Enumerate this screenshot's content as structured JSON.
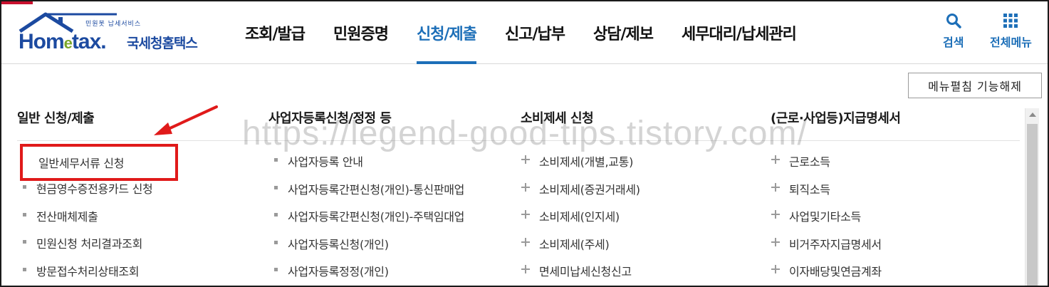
{
  "logo": {
    "tagline": "민원봇 납세서비스",
    "name_main": "Hom",
    "name_e": "e",
    "name_tail": "tax.",
    "name_kor": "국세청홈택스"
  },
  "nav": [
    {
      "label": "조회/발급",
      "active": false
    },
    {
      "label": "민원증명",
      "active": false
    },
    {
      "label": "신청/제출",
      "active": true
    },
    {
      "label": "신고/납부",
      "active": false
    },
    {
      "label": "상담/제보",
      "active": false
    },
    {
      "label": "세무대리/납세관리",
      "active": false
    }
  ],
  "header_actions": {
    "search": {
      "label": "검색",
      "icon": "search-icon"
    },
    "all_menu": {
      "label": "전체메뉴",
      "icon": "grid-icon"
    }
  },
  "toggle_button": "메뉴펼침 기능해제",
  "watermark": "https://legend-good-tips.tistory.com/",
  "columns": [
    {
      "title": "일반 신청/제출",
      "bullet": "square",
      "highlighted": "일반세무서류 신청",
      "items": [
        "현금영수증전용카드 신청",
        "전산매체제출",
        "민원신청 처리결과조회",
        "방문접수처리상태조회"
      ]
    },
    {
      "title": "사업자등록신청/정정 등",
      "bullet": "square",
      "items": [
        "사업자등록 안내",
        "사업자등록간편신청(개인)-통신판매업",
        "사업자등록간편신청(개인)-주택임대업",
        "사업자등록신청(개인)",
        "사업자등록정정(개인)"
      ]
    },
    {
      "title": "소비제세 신청",
      "bullet": "plus",
      "items": [
        "소비제세(개별,교통)",
        "소비제세(증권거래세)",
        "소비제세(인지세)",
        "소비제세(주세)",
        "면세미납세신청신고"
      ]
    },
    {
      "title": "(근로·사업등)지급명세서",
      "bullet": "plus",
      "items": [
        "근로소득",
        "퇴직소득",
        "사업및기타소득",
        "비거주자지급명세서",
        "이자배당및연금계좌"
      ]
    }
  ],
  "colors": {
    "brand_blue": "#1c4aa0",
    "accent_blue": "#1d6fb8",
    "highlight_red": "#e01a1a"
  }
}
